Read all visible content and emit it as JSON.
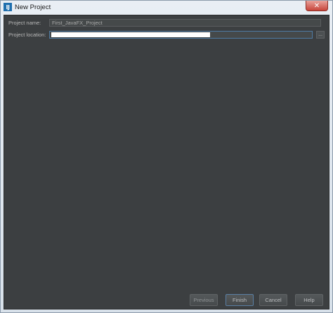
{
  "window": {
    "title": "New Project",
    "app_icon_glyph": "IJ",
    "close_glyph": "✕"
  },
  "form": {
    "project_name_label": "Project name:",
    "project_name_value": "First_JavaFX_Project",
    "project_location_label": "Project location:",
    "project_location_value": "",
    "browse_label": "..."
  },
  "buttons": {
    "previous": "Previous",
    "finish": "Finish",
    "cancel": "Cancel",
    "help": "Help"
  },
  "colors": {
    "background": "#3c3f41",
    "field_bg": "#45494a",
    "focus_border": "#4f7ba3"
  }
}
